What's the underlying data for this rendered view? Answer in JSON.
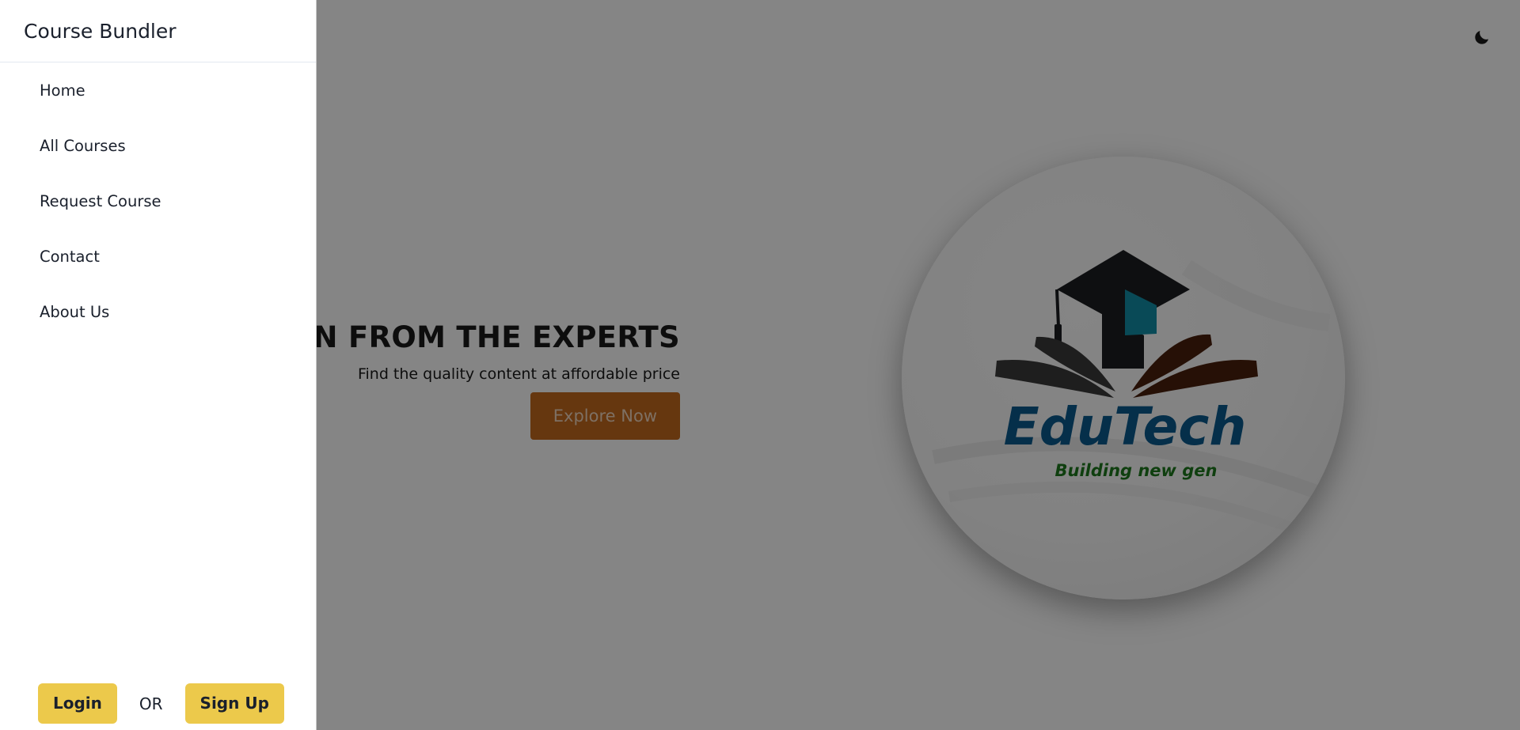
{
  "drawer": {
    "title": "Course Bundler",
    "nav": [
      {
        "label": "Home"
      },
      {
        "label": "All Courses"
      },
      {
        "label": "Request Course"
      },
      {
        "label": "Contact"
      },
      {
        "label": "About Us"
      }
    ],
    "login_label": "Login",
    "or_label": "OR",
    "signup_label": "Sign Up"
  },
  "hero": {
    "title": "LEARN FROM THE EXPERTS",
    "subtitle": "Find the quality content at affordable price",
    "explore_label": "Explore Now"
  },
  "logo": {
    "brand": "EduTech",
    "tagline": "Building new gen",
    "icon": "graduation-cap-book-logo"
  },
  "theme_toggle": {
    "icon": "moon-icon"
  },
  "colors": {
    "accent_yellow": "#ecc94b",
    "explore_orange": "#c46a1e",
    "brand_blue": "#0b5a8e",
    "tagline_green": "#1e7a1e"
  }
}
